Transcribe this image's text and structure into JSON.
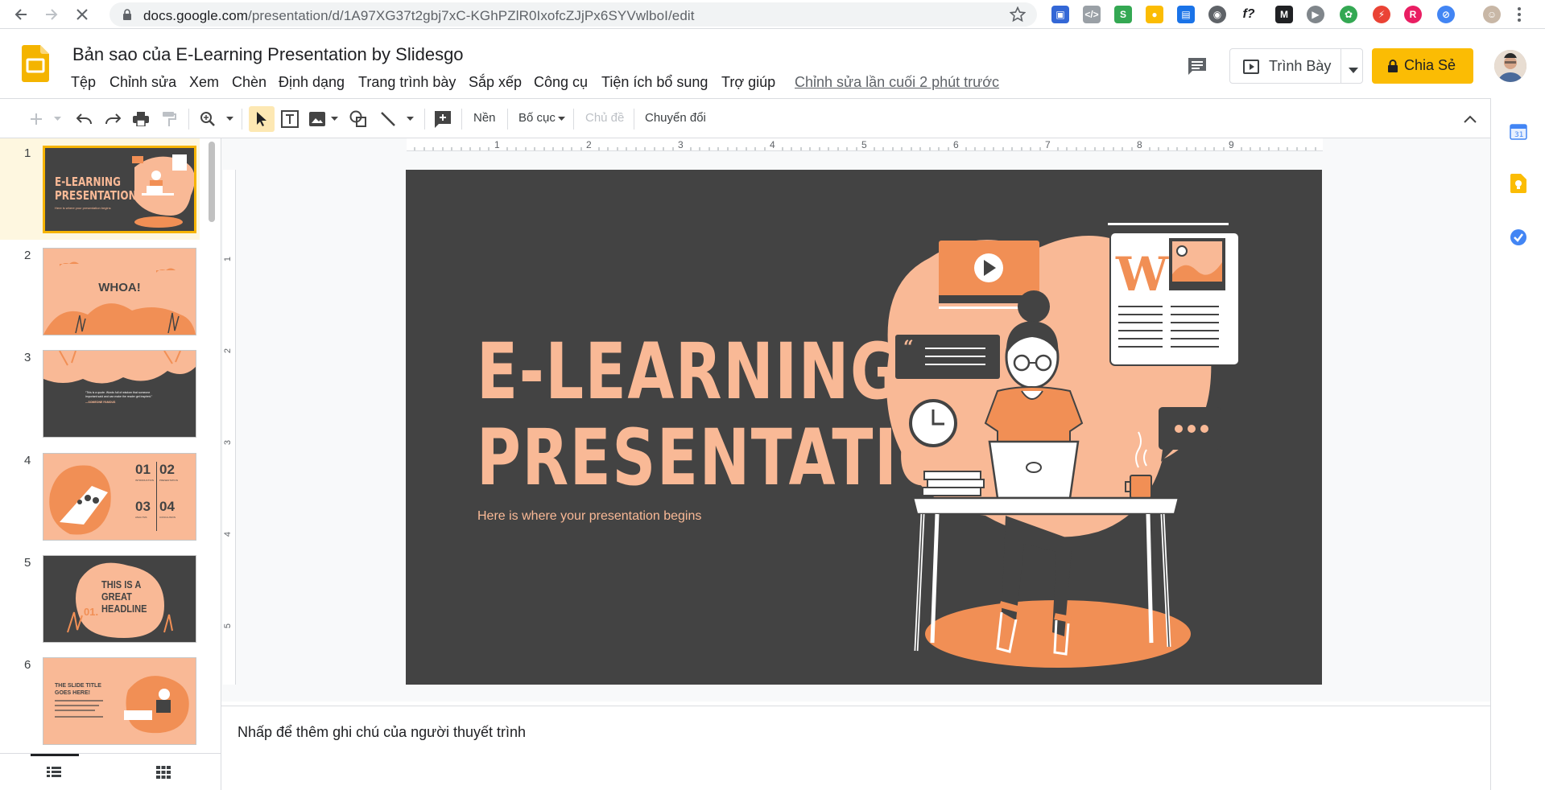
{
  "browser": {
    "url_host": "docs.google.com",
    "url_path": "/presentation/d/1A97XG37t2gbj7xC-KGhPZlR0IxofcZJjPx6SYVwlboI/edit"
  },
  "app": {
    "title": "Bản sao của E-Learning Presentation by Slidesgo",
    "menu": [
      "Tệp",
      "Chỉnh sửa",
      "Xem",
      "Chèn",
      "Định dạng",
      "Trang trình bày",
      "Sắp xếp",
      "Công cụ",
      "Tiện ích bổ sung",
      "Trợ giúp"
    ],
    "last_edit": "Chỉnh sửa lần cuối 2 phút trước",
    "present_label": "Trình Bày",
    "share_label": "Chia Sẻ"
  },
  "toolbar": {
    "background": "Nền",
    "layout": "Bố cục",
    "theme": "Chủ đề",
    "transition": "Chuyển đổi"
  },
  "ruler": {
    "h_ticks": [
      "1",
      "2",
      "3",
      "4",
      "5",
      "6",
      "7",
      "8",
      "9"
    ],
    "v_ticks": [
      "1",
      "2",
      "3",
      "4",
      "5"
    ]
  },
  "filmstrip": {
    "slides": [
      {
        "num": "1",
        "text": "E-LEARNING PRESENTATION",
        "sub": "Here is where your presentation begins"
      },
      {
        "num": "2",
        "text": "WHOA!"
      },
      {
        "num": "3",
        "text": "“This is a quote. Words full of wisdom that someone important said and can make the reader get inspired.”",
        "sub": "—SOMEONE FAMOUS"
      },
      {
        "num": "4",
        "items": [
          "01",
          "02",
          "03",
          "04"
        ],
        "labels": [
          "INTRODUCTION",
          "PRESENTATION",
          "ANALYSIS",
          "CONCLUSION"
        ]
      },
      {
        "num": "5",
        "text": "THIS IS A GREAT HEADLINE",
        "sub": "01."
      },
      {
        "num": "6",
        "text": "THE SLIDE TITLE GOES HERE!"
      }
    ]
  },
  "slide": {
    "title_line1": "E-LEARNING",
    "title_line2": "PRESENTATION",
    "subtitle": "Here is where your presentation begins",
    "newspaper_letter": "W"
  },
  "notes": {
    "placeholder": "Nhấp để thêm ghi chú của người thuyết trình"
  },
  "colors": {
    "slide_bg": "#434343",
    "accent_peach": "#f9b996",
    "accent_orange": "#f18f55",
    "share_yellow": "#fbbc04"
  }
}
